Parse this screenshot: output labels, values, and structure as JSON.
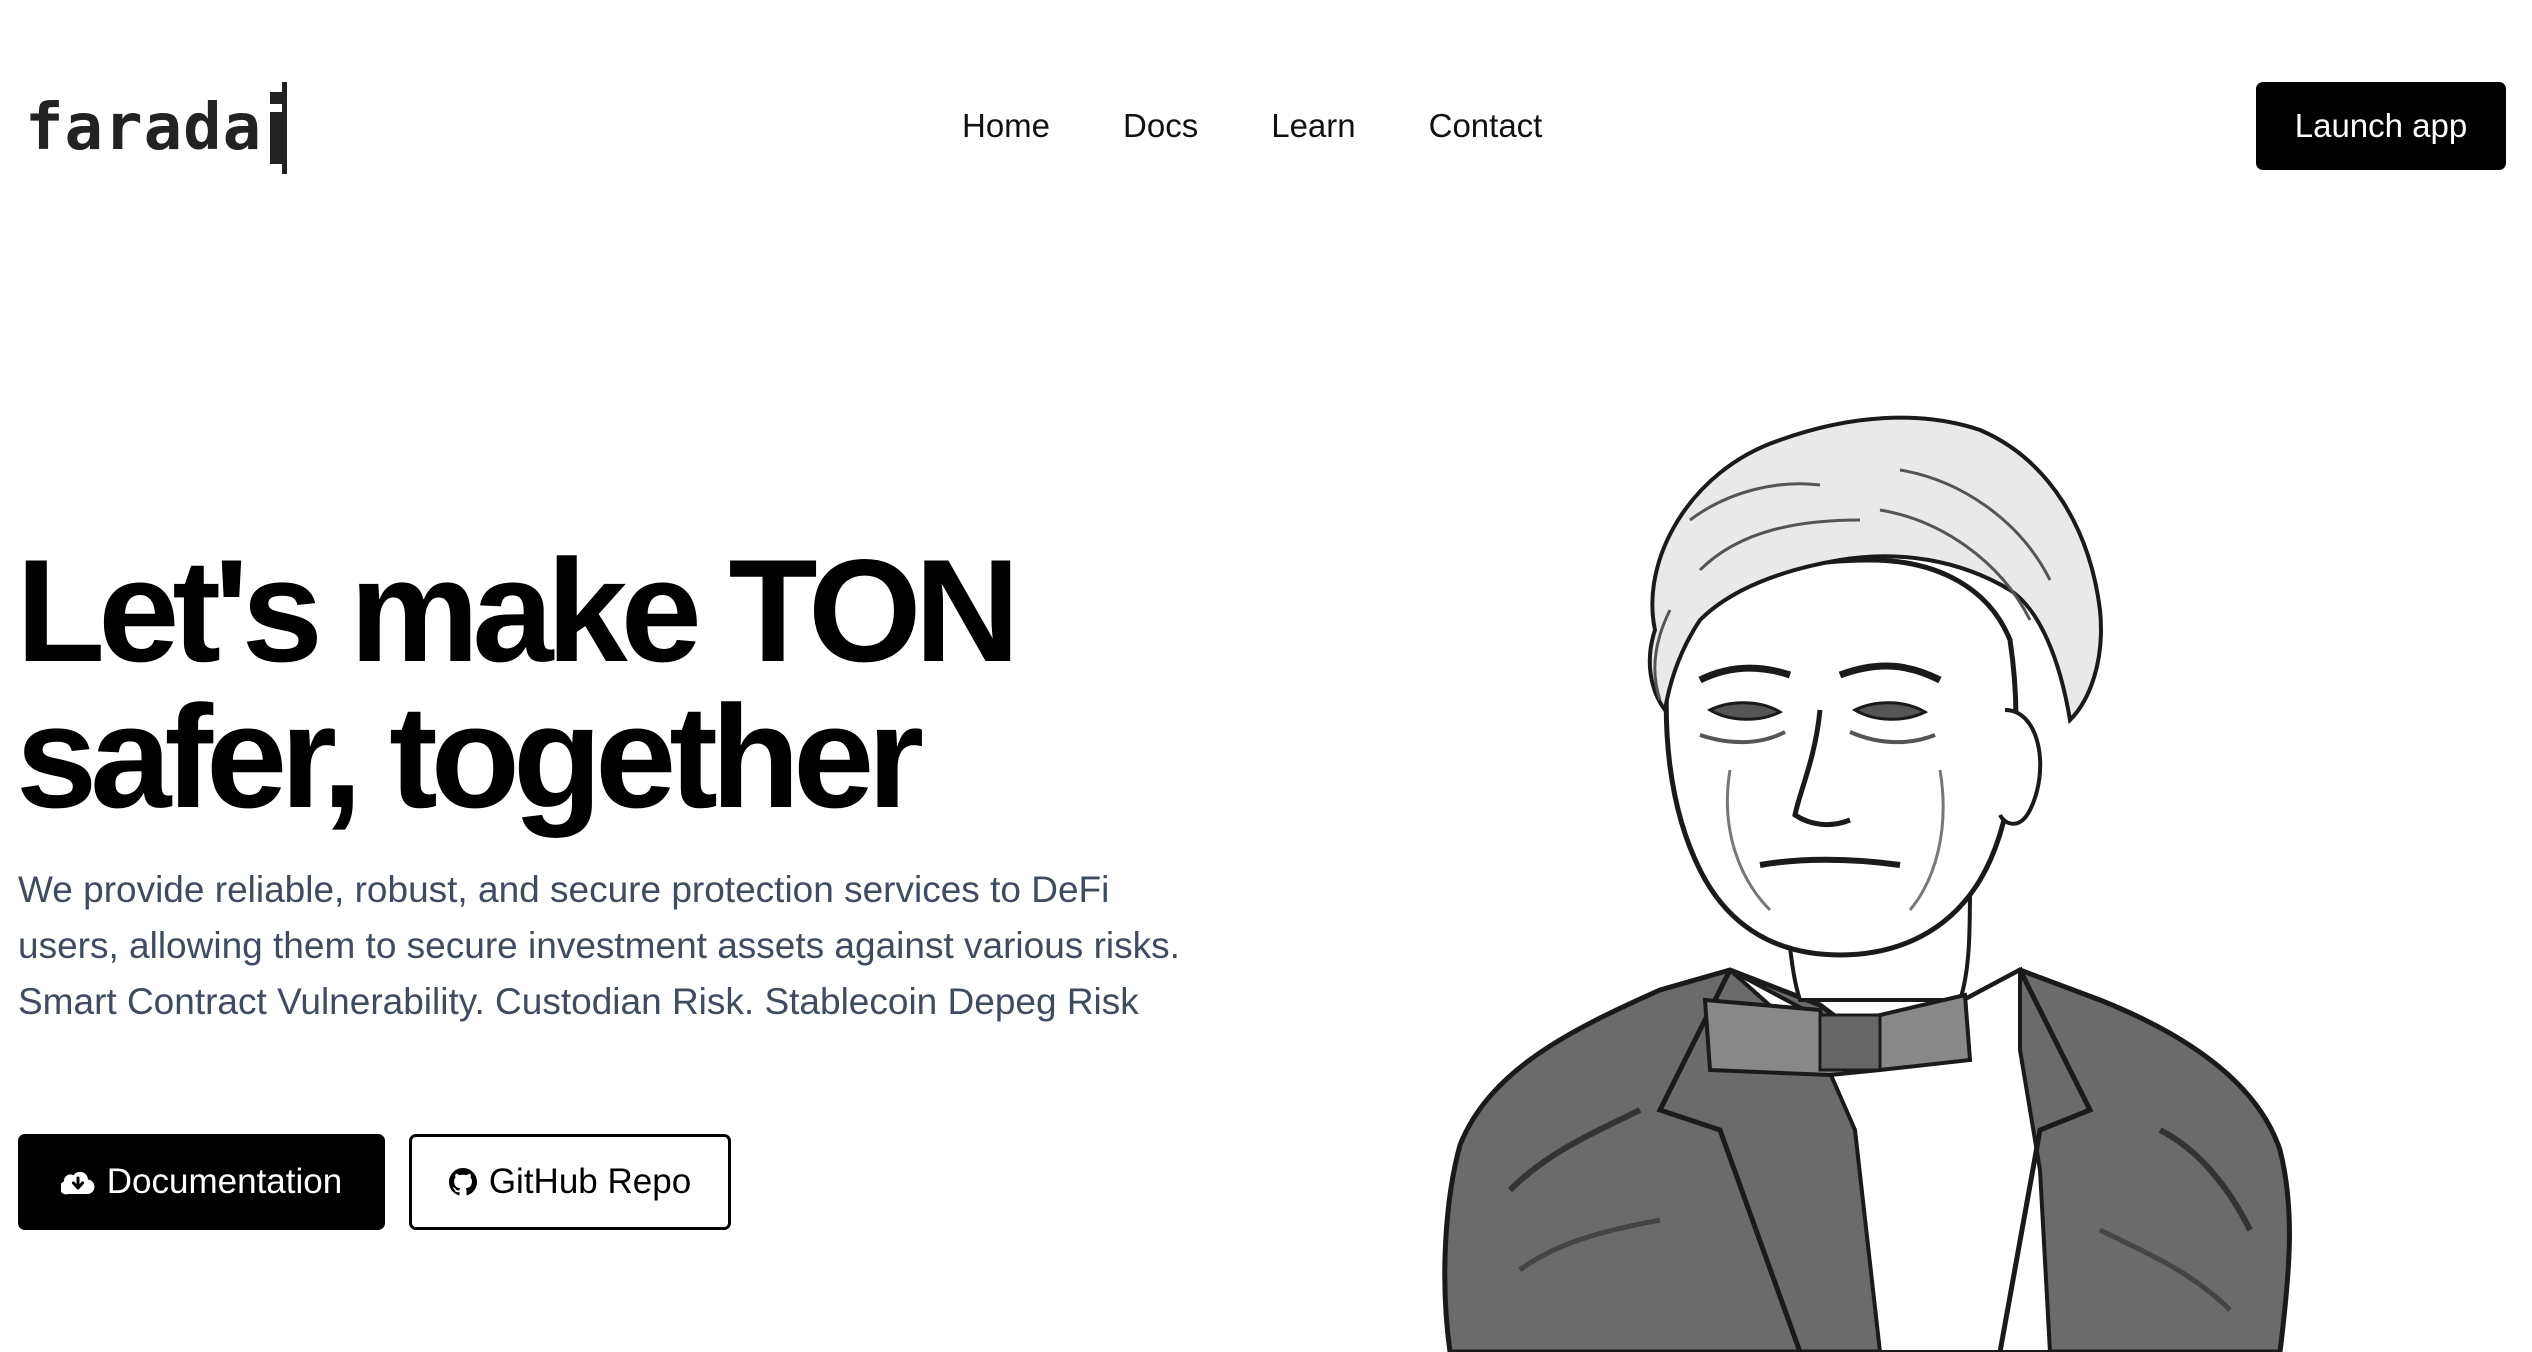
{
  "header": {
    "logo_text": "farada",
    "nav": [
      {
        "label": "Home"
      },
      {
        "label": "Docs"
      },
      {
        "label": "Learn"
      },
      {
        "label": "Contact"
      }
    ],
    "launch_label": "Launch app"
  },
  "hero": {
    "headline_line1": "Let's make TON",
    "headline_line2": "safer, together",
    "description": "We provide reliable, robust, and secure protection services to DeFi users, allowing them to secure investment assets against various risks. Smart Contract Vulnerability. Custodian Risk. Stablecoin Depeg Risk",
    "buttons": {
      "documentation_label": "Documentation",
      "documentation_icon": "cloud-download-icon",
      "github_label": "GitHub Repo",
      "github_icon": "github-icon"
    }
  },
  "colors": {
    "primary": "#000000",
    "description_text": "#3f4b5e",
    "background": "#ffffff"
  }
}
